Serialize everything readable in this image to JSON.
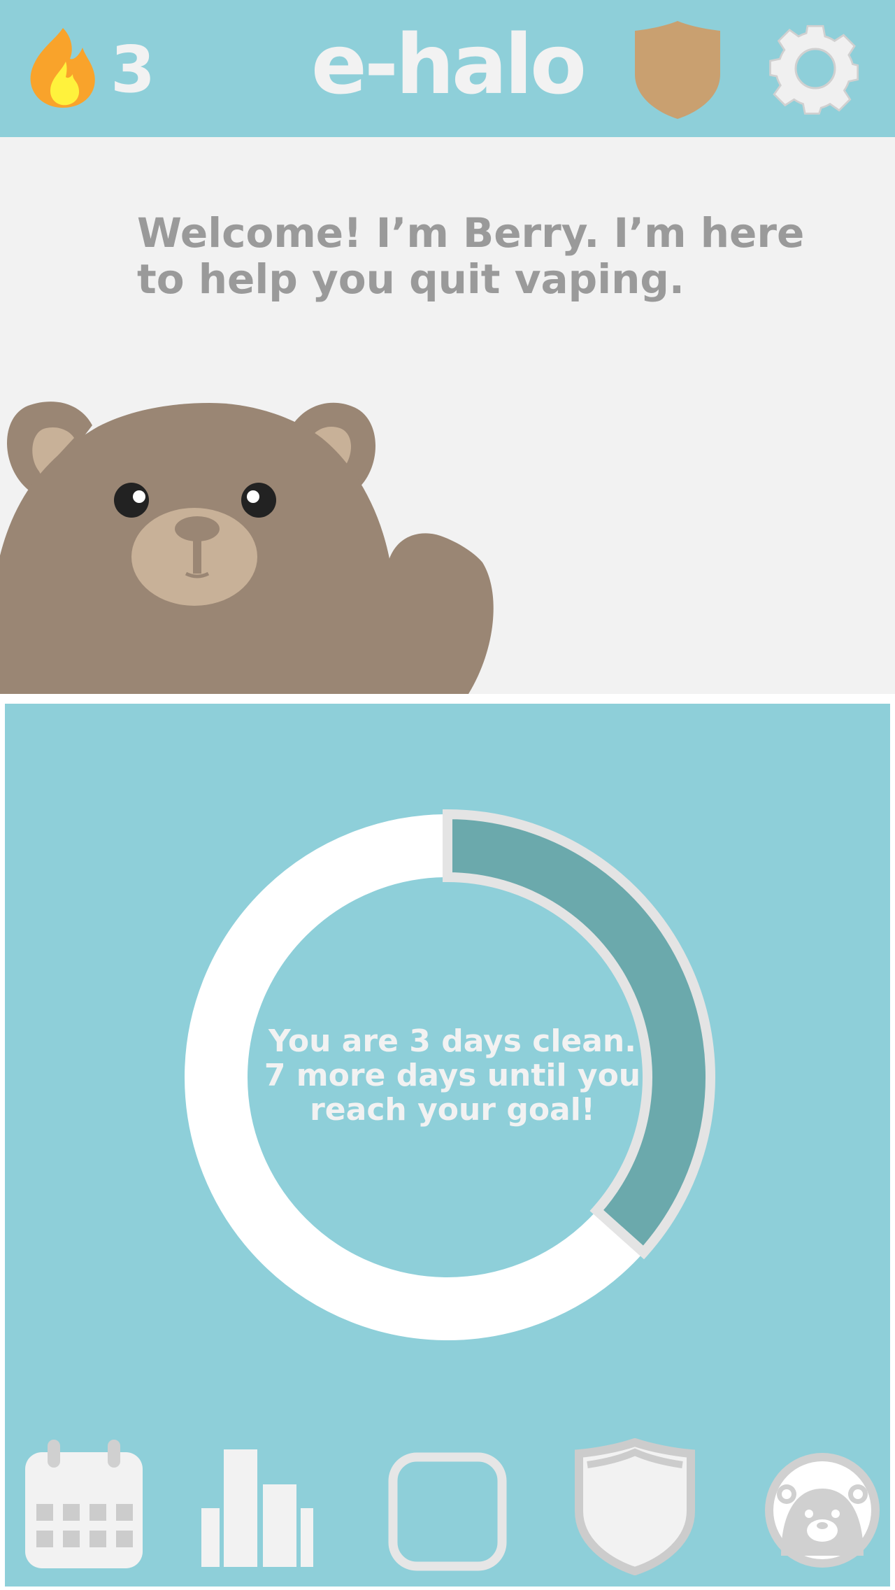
{
  "header": {
    "streak_count": "3",
    "app_title": "e-halo",
    "icons": {
      "streak": "fire-icon",
      "shield": "shield-icon",
      "settings": "gear-icon"
    }
  },
  "welcome": {
    "message": "Welcome! I’m Berry. I’m here to help you quit vaping.",
    "mascot": "bear-mascot"
  },
  "progress": {
    "message": "You are 3 days clean. 7 more days until you reach your goal!",
    "days_clean": 3,
    "goal_days": 10,
    "fraction_complete": 0.3
  },
  "bottom_nav": [
    {
      "id": "calendar",
      "icon": "calendar-icon"
    },
    {
      "id": "stats",
      "icon": "bar-chart-icon"
    },
    {
      "id": "home",
      "icon": "square-icon"
    },
    {
      "id": "shield",
      "icon": "shield-icon"
    },
    {
      "id": "profile",
      "icon": "bear-avatar-icon"
    }
  ],
  "colors": {
    "accent": "#8ecfd9",
    "progress_fill": "#6ba9ac",
    "panel_bg": "#f2f2f2",
    "bear_brown": "#9a8674",
    "bear_light": "#c8b198",
    "shield_tan": "#c9a070",
    "text_gray": "#9a9a9a"
  }
}
